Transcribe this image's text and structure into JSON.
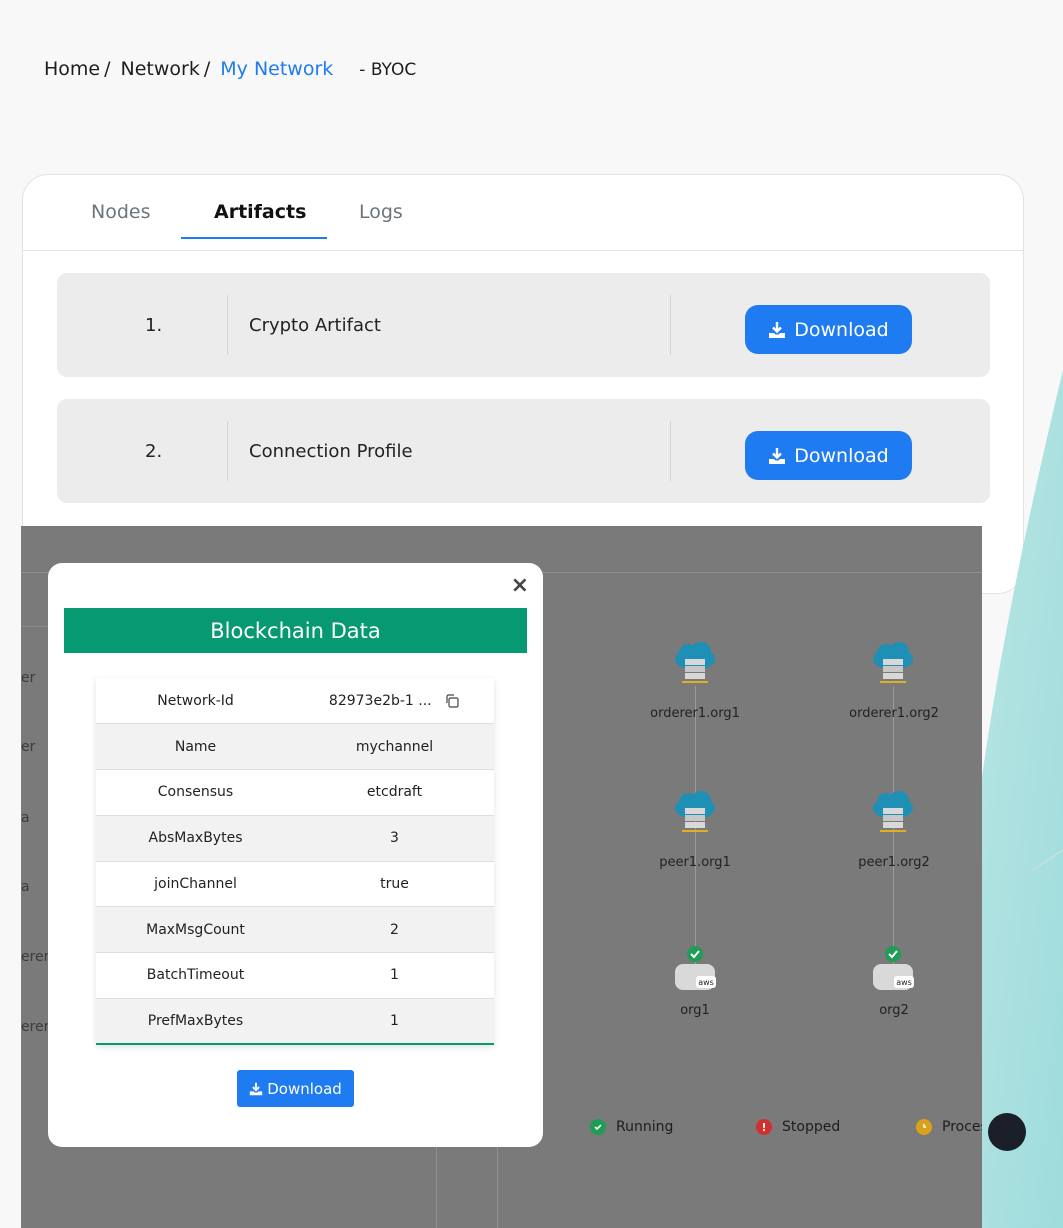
{
  "breadcrumb": {
    "home": "Home",
    "network": "Network",
    "current": "My Network",
    "suffix": "- BYOC",
    "separator": "/"
  },
  "tabs": {
    "nodes": "Nodes",
    "artifacts": "Artifacts",
    "logs": "Logs",
    "active": "Artifacts"
  },
  "artifacts": [
    {
      "num": "1.",
      "name": "Crypto Artifact",
      "button": "Download"
    },
    {
      "num": "2.",
      "name": "Connection Profile",
      "button": "Download"
    }
  ],
  "side_labels": [
    "er",
    "er",
    "a",
    "a",
    "erer",
    "erer"
  ],
  "topology": {
    "nodes": {
      "orderer1_org1": "orderer1.org1",
      "orderer1_org2": "orderer1.org2",
      "peer1_org1": "peer1.org1",
      "peer1_org2": "peer1.org2",
      "org1": "org1",
      "org2": "org2"
    },
    "legend": {
      "running": "Running",
      "stopped": "Stopped",
      "processing": "Proces"
    }
  },
  "modal": {
    "close": "×",
    "title": "Blockchain Data",
    "rows": [
      {
        "key": "Network-Id",
        "value": "82973e2b-1 ..."
      },
      {
        "key": "Name",
        "value": "mychannel"
      },
      {
        "key": "Consensus",
        "value": "etcdraft"
      },
      {
        "key": "AbsMaxBytes",
        "value": "3"
      },
      {
        "key": "joinChannel",
        "value": "true"
      },
      {
        "key": "MaxMsgCount",
        "value": "2"
      },
      {
        "key": "BatchTimeout",
        "value": "1"
      },
      {
        "key": "PrefMaxBytes",
        "value": "1"
      }
    ],
    "download": "Download"
  },
  "colors": {
    "accent": "#1f7bf2",
    "header_green": "#079a72",
    "running": "#1f9d55",
    "stopped": "#d32f2f",
    "processing": "#d8a21a"
  }
}
